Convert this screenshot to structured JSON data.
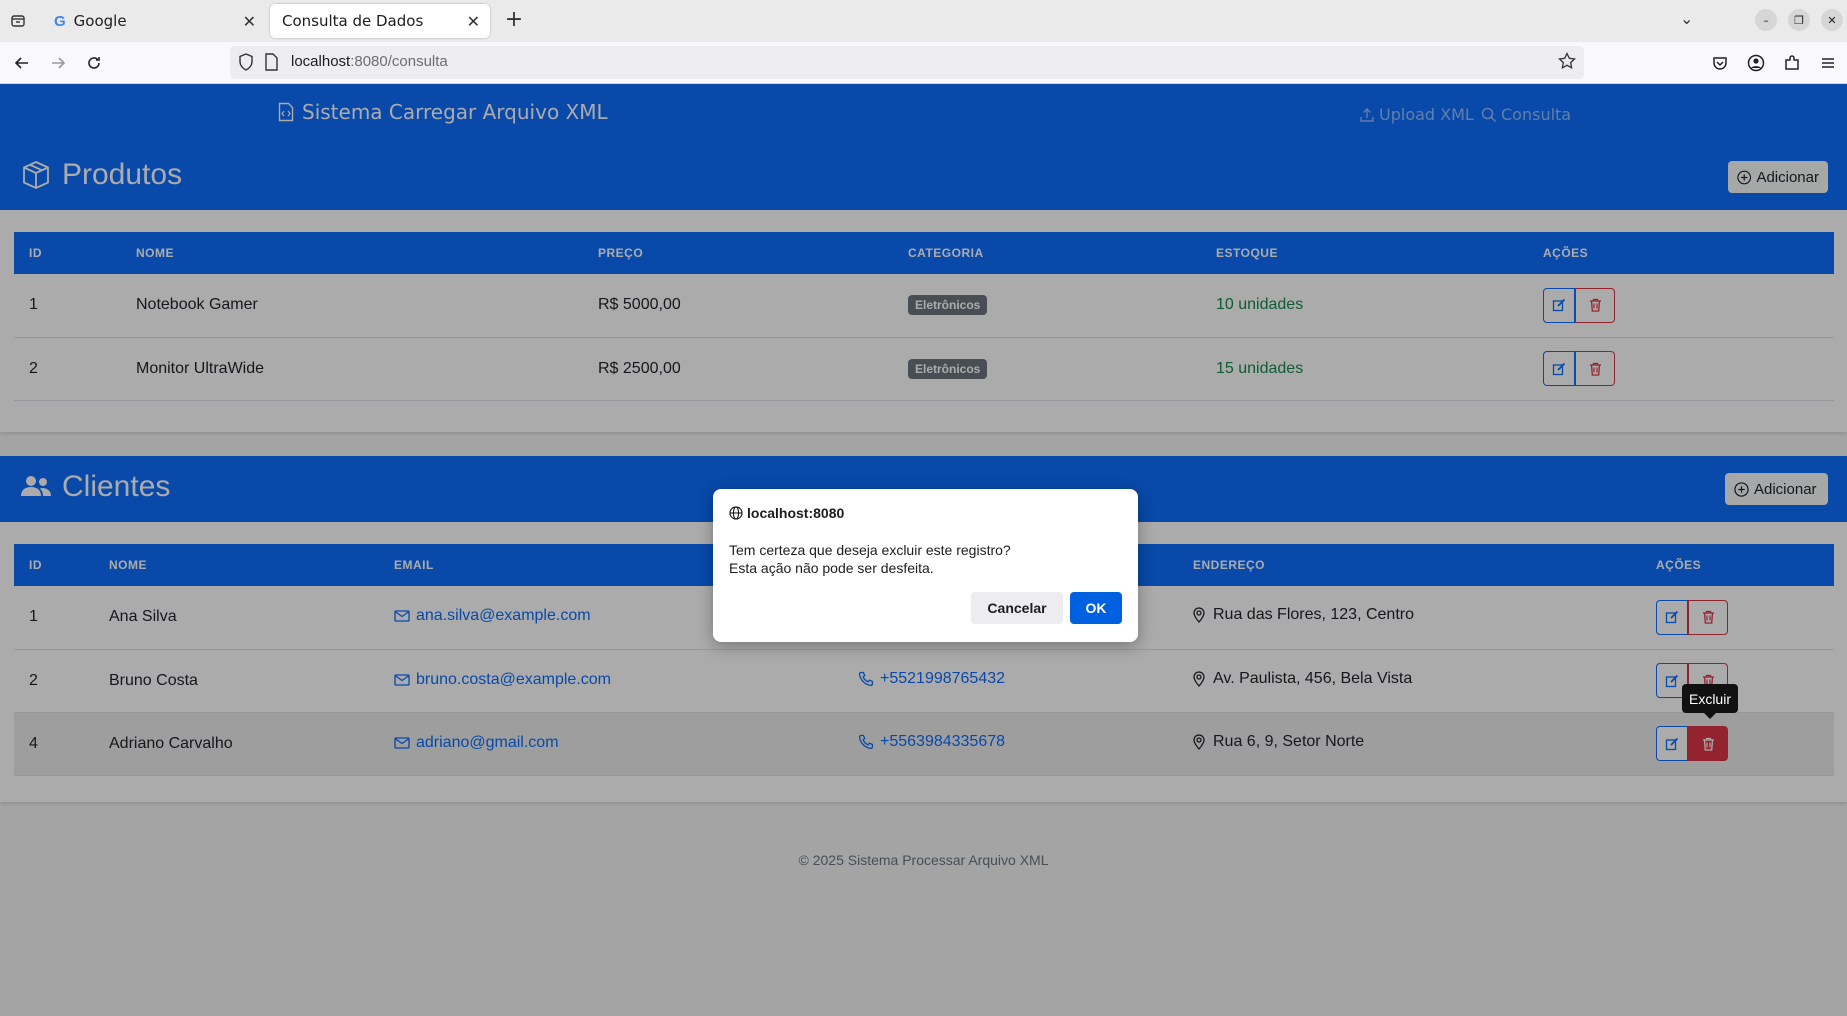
{
  "browser": {
    "tabs": [
      {
        "label": "Google",
        "active": false
      },
      {
        "label": "Consulta de Dados",
        "active": true
      }
    ],
    "url_host": "localhost",
    "url_rest": ":8080/consulta"
  },
  "header": {
    "brand": "Sistema Carregar Arquivo XML",
    "nav": [
      {
        "label": "Upload XML",
        "icon": "upload-icon"
      },
      {
        "label": "Consulta",
        "icon": "search-icon"
      }
    ]
  },
  "produtos": {
    "title": "Produtos",
    "add_label": "Adicionar",
    "columns": [
      "ID",
      "NOME",
      "PREÇO",
      "CATEGORIA",
      "ESTOQUE",
      "AÇÕES"
    ],
    "rows": [
      {
        "id": "1",
        "nome": "Notebook Gamer",
        "preco": "R$ 5000,00",
        "categoria": "Eletrônicos",
        "estoque": "10 unidades"
      },
      {
        "id": "2",
        "nome": "Monitor UltraWide",
        "preco": "R$ 2500,00",
        "categoria": "Eletrônicos",
        "estoque": "15 unidades"
      }
    ]
  },
  "clientes": {
    "title": "Clientes",
    "add_label": "Adicionar",
    "columns": [
      "ID",
      "NOME",
      "EMAIL",
      "",
      "ENDEREÇO",
      "AÇÕES"
    ],
    "rows": [
      {
        "id": "1",
        "nome": "Ana Silva",
        "email": "ana.silva@example.com",
        "telefone": "",
        "endereco": "Rua das Flores, 123, Centro"
      },
      {
        "id": "2",
        "nome": "Bruno Costa",
        "email": "bruno.costa@example.com",
        "telefone": "+5521998765432",
        "endereco": "Av. Paulista, 456, Bela Vista"
      },
      {
        "id": "4",
        "nome": "Adriano Carvalho",
        "email": "adriano@gmail.com",
        "telefone": "+5563984335678",
        "endereco": "Rua 6, 9, Setor Norte"
      }
    ]
  },
  "tooltip": "Excluir",
  "footer": "© 2025 Sistema Processar Arquivo XML",
  "dialog": {
    "origin": "localhost:8080",
    "line1": "Tem certeza que deseja excluir este registro?",
    "line2": "Esta ação não pode ser desfeita.",
    "cancel": "Cancelar",
    "ok": "OK"
  },
  "colors": {
    "primary": "#0d6efd",
    "danger": "#dc3545",
    "success": "#198754",
    "secondary": "#6c757d"
  }
}
